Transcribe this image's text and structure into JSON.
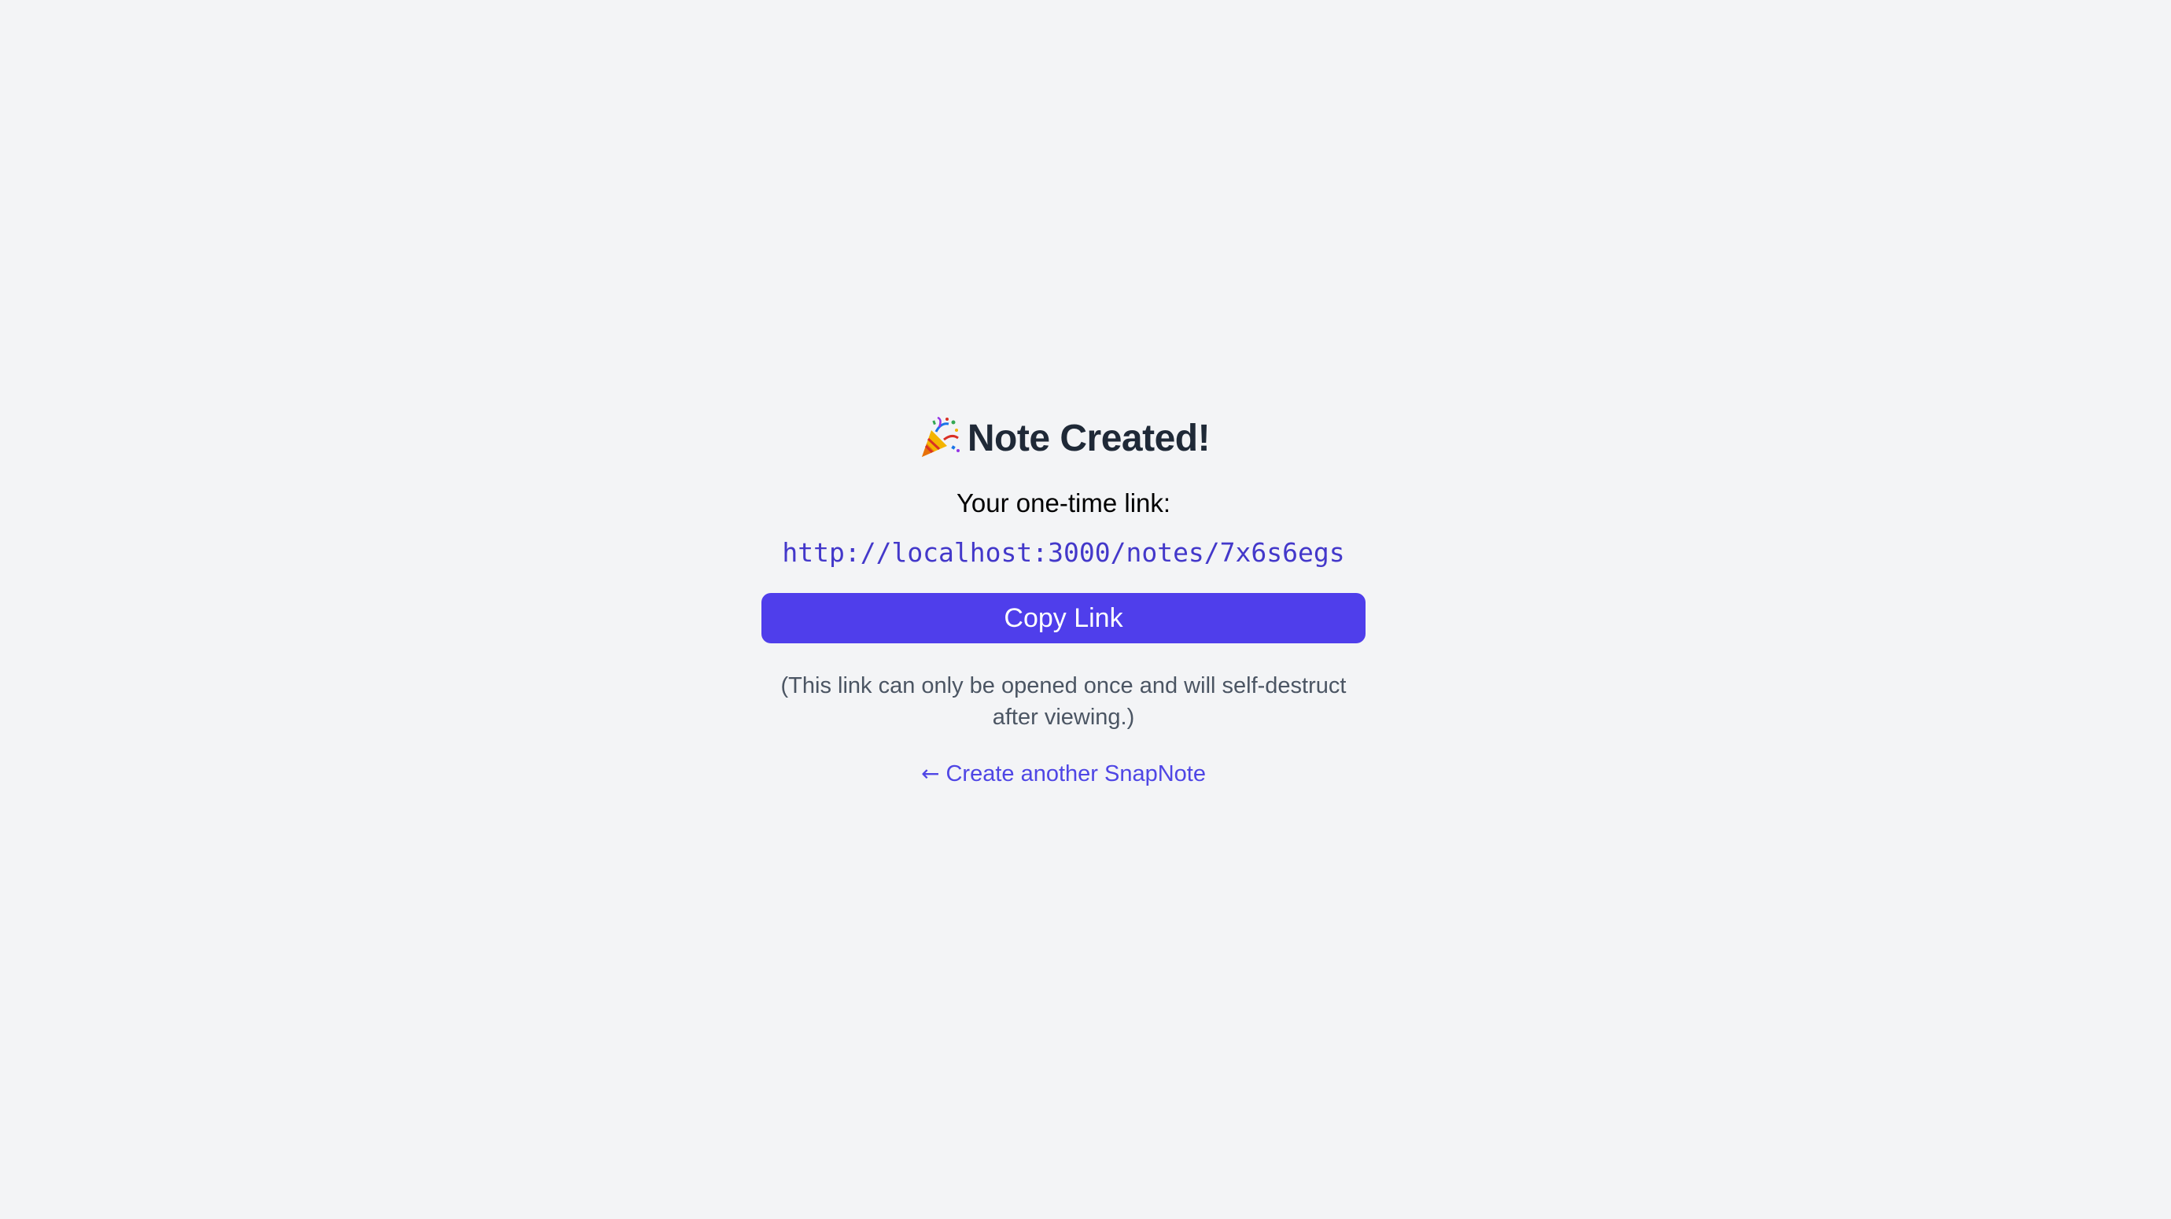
{
  "header": {
    "icon": "party-popper-icon",
    "title": "Note Created!"
  },
  "main": {
    "subtitle": "Your one-time link:",
    "link": "http://localhost:3000/notes/7x6s6egs",
    "copy_label": "Copy Link",
    "note": "(This link can only be opened once and will self-destruct after viewing.)",
    "back_arrow": "←",
    "back_label": "Create another SnapNote"
  },
  "colors": {
    "background": "#f3f4f6",
    "accent": "#4f3eeb",
    "link": "#4338ca",
    "title": "#1f2937",
    "muted": "#4b5563"
  }
}
